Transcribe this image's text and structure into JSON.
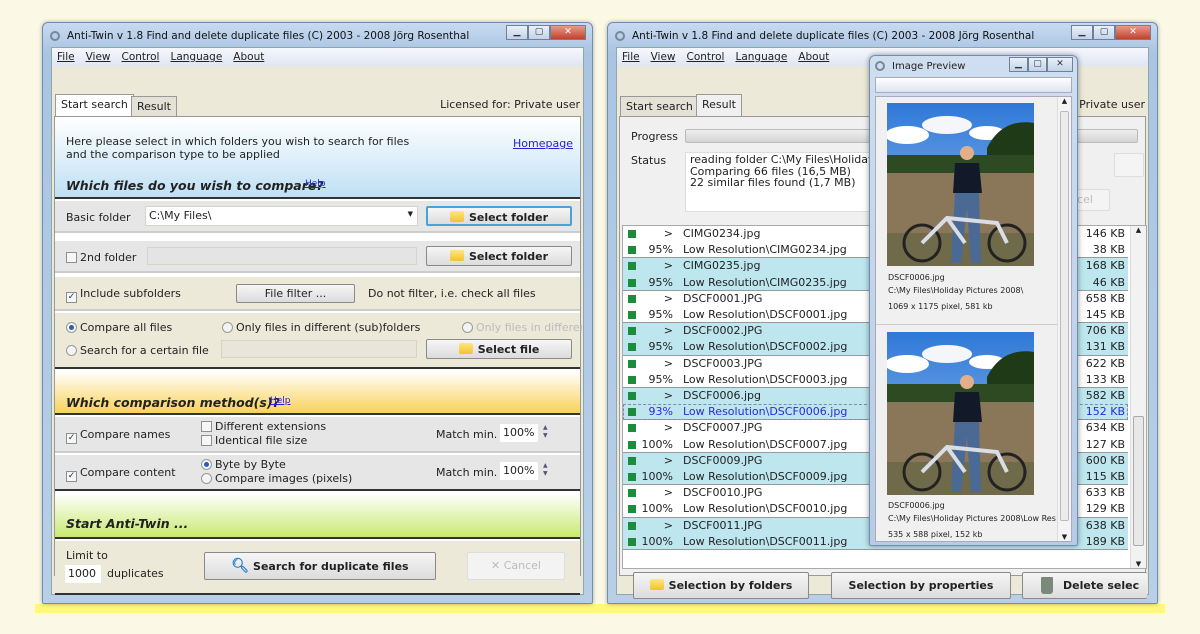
{
  "window_title": "Anti-Twin   v 1.8    Find and delete duplicate files    (C) 2003 - 2008  Jörg Rosenthal",
  "menu": [
    "File",
    "View",
    "Control",
    "Language",
    "About"
  ],
  "tabs": [
    "Start search",
    "Result"
  ],
  "licensed": "Licensed for: Private user",
  "licensed_partial": "Private user",
  "start": {
    "intro_line1": "Here please select in which folders you wish to search for files",
    "intro_line2": "and the comparison type to be applied",
    "homepage": "Homepage",
    "files_heading": "Which files do you wish to compare?",
    "help": "Help",
    "basic_folder_label": "Basic folder",
    "basic_folder_value": "C:\\My Files\\",
    "select_folder": "Select folder",
    "second_folder_label": "2nd folder",
    "include_subfolders": "Include subfolders",
    "file_filter": "File filter ...",
    "filter_desc": "Do not filter, i.e. check all files",
    "compare_all": "Compare all files",
    "only_different": "Only files in different (sub)folders",
    "only_different2": "Only files in differen",
    "search_certain": "Search for a certain file",
    "select_file": "Select file",
    "method_heading": "Which comparison method(s)?",
    "compare_names": "Compare names",
    "different_extensions": "Different extensions",
    "identical_size": "Identical file size",
    "match_min": "Match min.",
    "match_names_value": "100%",
    "compare_content": "Compare content",
    "byte_by_byte": "Byte by Byte",
    "compare_images": "Compare images (pixels)",
    "match_content_value": "100%",
    "start_heading": "Start Anti-Twin ...",
    "limit_to": "Limit to",
    "limit_value": "1000",
    "duplicates": "duplicates",
    "search_button": "Search for duplicate files",
    "cancel": "Cancel"
  },
  "result": {
    "progress_label": "Progress",
    "progress": 0,
    "status_label": "Status",
    "status_lines": [
      "reading folder C:\\My Files\\Holiday P",
      "Comparing 66 files (16,5 MB)",
      "22 similar files found (1,7 MB)"
    ],
    "cancel_partial": "cel",
    "rows": [
      {
        "pct": ">",
        "name": "CIMG0234.jpg",
        "size": "146 KB"
      },
      {
        "pct": "95%",
        "name": "Low Resolution\\CIMG0234.jpg",
        "size": "38 KB"
      },
      {
        "pct": ">",
        "name": "CIMG0235.jpg",
        "size": "168 KB"
      },
      {
        "pct": "95%",
        "name": "Low Resolution\\CIMG0235.jpg",
        "size": "46 KB"
      },
      {
        "pct": ">",
        "name": "DSCF0001.JPG",
        "size": "658 KB"
      },
      {
        "pct": "95%",
        "name": "Low Resolution\\DSCF0001.jpg",
        "size": "145 KB"
      },
      {
        "pct": ">",
        "name": "DSCF0002.JPG",
        "size": "706 KB"
      },
      {
        "pct": "95%",
        "name": "Low Resolution\\DSCF0002.jpg",
        "size": "131 KB"
      },
      {
        "pct": ">",
        "name": "DSCF0003.JPG",
        "size": "622 KB"
      },
      {
        "pct": "95%",
        "name": "Low Resolution\\DSCF0003.jpg",
        "size": "133 KB"
      },
      {
        "pct": ">",
        "name": "DSCF0006.jpg",
        "size": "582 KB"
      },
      {
        "pct": "93%",
        "name": "Low Resolution\\DSCF0006.jpg",
        "size": "152 KB"
      },
      {
        "pct": ">",
        "name": "DSCF0007.JPG",
        "size": "634 KB"
      },
      {
        "pct": "100%",
        "name": "Low Resolution\\DSCF0007.jpg",
        "size": "127 KB"
      },
      {
        "pct": ">",
        "name": "DSCF0009.JPG",
        "size": "600 KB"
      },
      {
        "pct": "100%",
        "name": "Low Resolution\\DSCF0009.jpg",
        "size": "115 KB"
      },
      {
        "pct": ">",
        "name": "DSCF0010.JPG",
        "size": "633 KB"
      },
      {
        "pct": "100%",
        "name": "Low Resolution\\DSCF0010.jpg",
        "size": "129 KB"
      },
      {
        "pct": ">",
        "name": "DSCF0011.JPG",
        "size": "638 KB"
      },
      {
        "pct": "100%",
        "name": "Low Resolution\\DSCF0011.jpg",
        "size": "189 KB"
      }
    ],
    "selected_row": 11,
    "selection_by_folders": "Selection by folders",
    "selection_by_properties": "Selection by properties",
    "delete_selected": "Delete selec"
  },
  "preview": {
    "title": "Image Preview",
    "images": [
      {
        "file": "DSCF0006.jpg",
        "path": "C:\\My Files\\Holiday Pictures 2008\\",
        "info": "1069 x 1175 pixel, 581 kb"
      },
      {
        "file": "DSCF0006.jpg",
        "path": "C:\\My Files\\Holiday Pictures 2008\\Low Res",
        "info": "535 x 588 pixel, 152 kb"
      }
    ]
  },
  "colors": {
    "highlight_row": "#bde6ee",
    "status_square": "#1e8a3c",
    "link": "#2222dd",
    "section_blue": "#bfe0f4",
    "section_yellow": "#f8d25a",
    "section_green": "#c9ea70"
  }
}
